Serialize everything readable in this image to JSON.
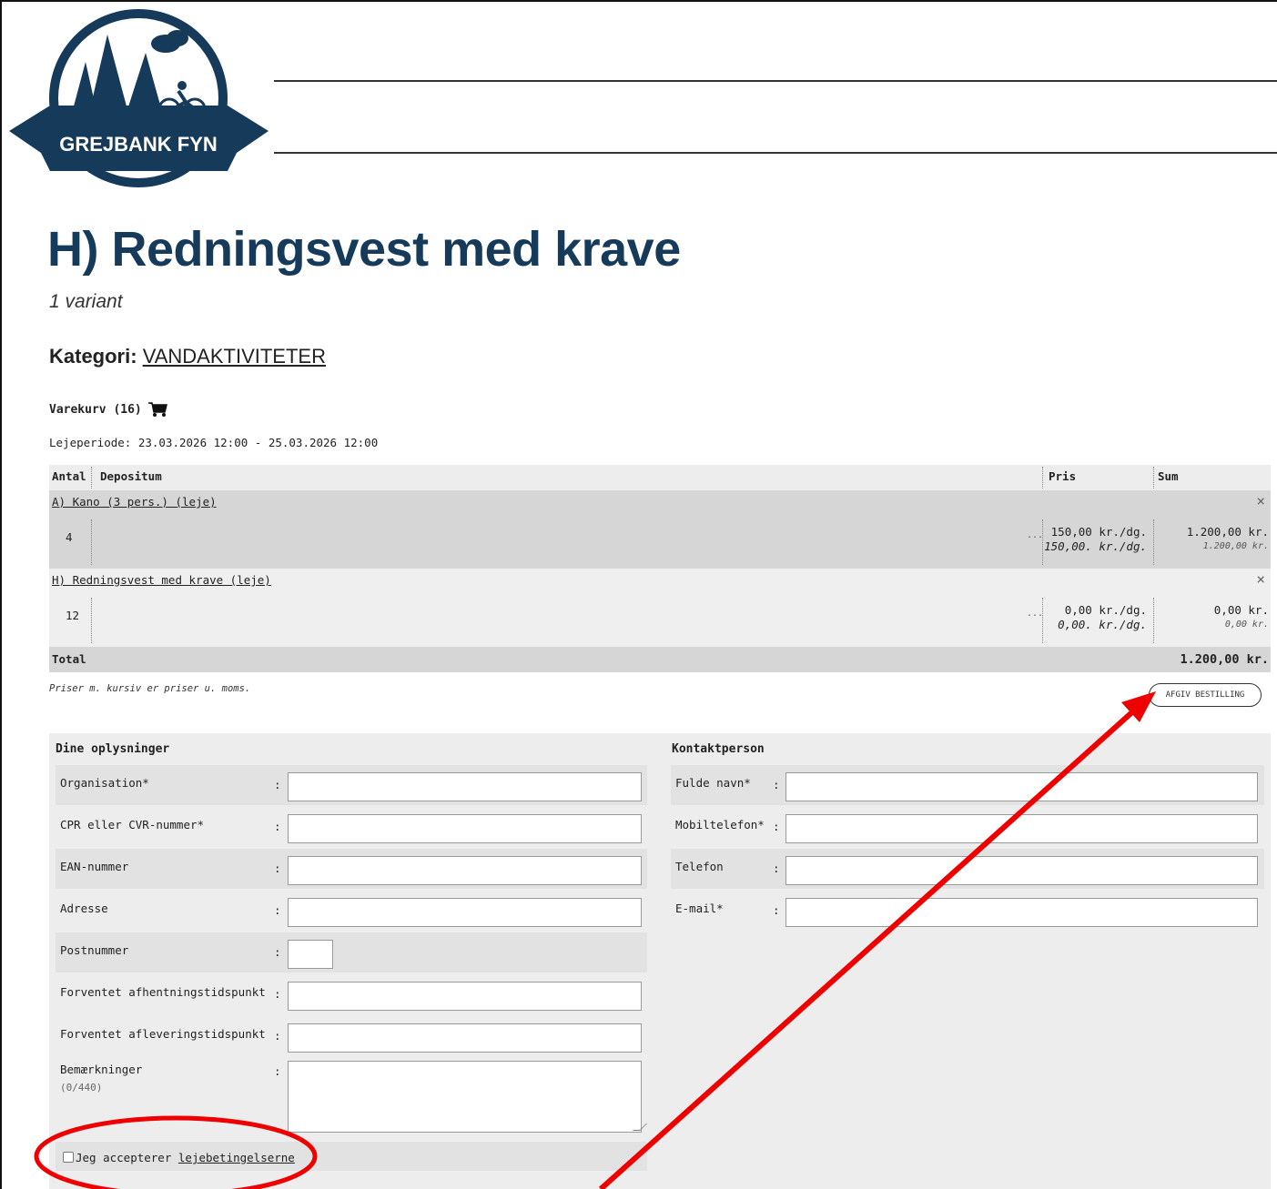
{
  "logo": {
    "text": "GREJBANK FYN",
    "brand_color": "#163a59"
  },
  "product": {
    "title": "H) Redningsvest med krave",
    "variant_count": "1 variant",
    "category_label": "Kategori:",
    "category_value": "VANDAKTIVITETER"
  },
  "cart": {
    "heading": "Varekurv (16)",
    "icon": "cart-icon",
    "period": "Lejeperiode: 23.03.2026 12:00 - 25.03.2026 12:00",
    "columns": {
      "antal": "Antal",
      "depositum": "Depositum",
      "pris": "Pris",
      "sum": "Sum"
    },
    "items": [
      {
        "name": "A) Kano (3 pers.) (leje)",
        "qty": "4",
        "ellipsis": "...",
        "price": "150,00 kr./dg.",
        "price_ex": "150,00. kr./dg.",
        "sum": "1.200,00 kr.",
        "sum_ex": "1.200,00 kr.",
        "remove": "×"
      },
      {
        "name": "H) Redningsvest med krave (leje)",
        "qty": "12",
        "ellipsis": "...",
        "price": "0,00 kr./dg.",
        "price_ex": "0,00. kr./dg.",
        "sum": "0,00 kr.",
        "sum_ex": "0,00 kr.",
        "remove": "×"
      }
    ],
    "total_label": "Total",
    "total_value": "1.200,00 kr.",
    "note": "Priser m. kursiv er priser u. moms.",
    "order_button": "AFGIV BESTILLING"
  },
  "form": {
    "left_title": "Dine oplysninger",
    "right_title": "Kontaktperson",
    "colon": ":",
    "left_fields": [
      {
        "label": "Organisation*",
        "value": ""
      },
      {
        "label": "CPR eller CVR-nummer*",
        "value": ""
      },
      {
        "label": "EAN-nummer",
        "value": ""
      },
      {
        "label": "Adresse",
        "value": ""
      },
      {
        "label": "Postnummer",
        "value": ""
      },
      {
        "label": "Forventet afhentningstidspunkt",
        "value": ""
      },
      {
        "label": "Forventet afleveringstidspunkt",
        "value": ""
      }
    ],
    "remarks_label": "Bemærkninger",
    "remarks_counter": "(0/440)",
    "right_fields": [
      {
        "label": "Fulde navn*",
        "value": ""
      },
      {
        "label": "Mobiltelefon*",
        "value": ""
      },
      {
        "label": "Telefon",
        "value": ""
      },
      {
        "label": "E-mail*",
        "value": ""
      }
    ],
    "accept_prefix": "Jeg accepterer",
    "accept_link": "lejebetingelserne",
    "accept_checked": false
  },
  "annotation_color": "#ee0000"
}
